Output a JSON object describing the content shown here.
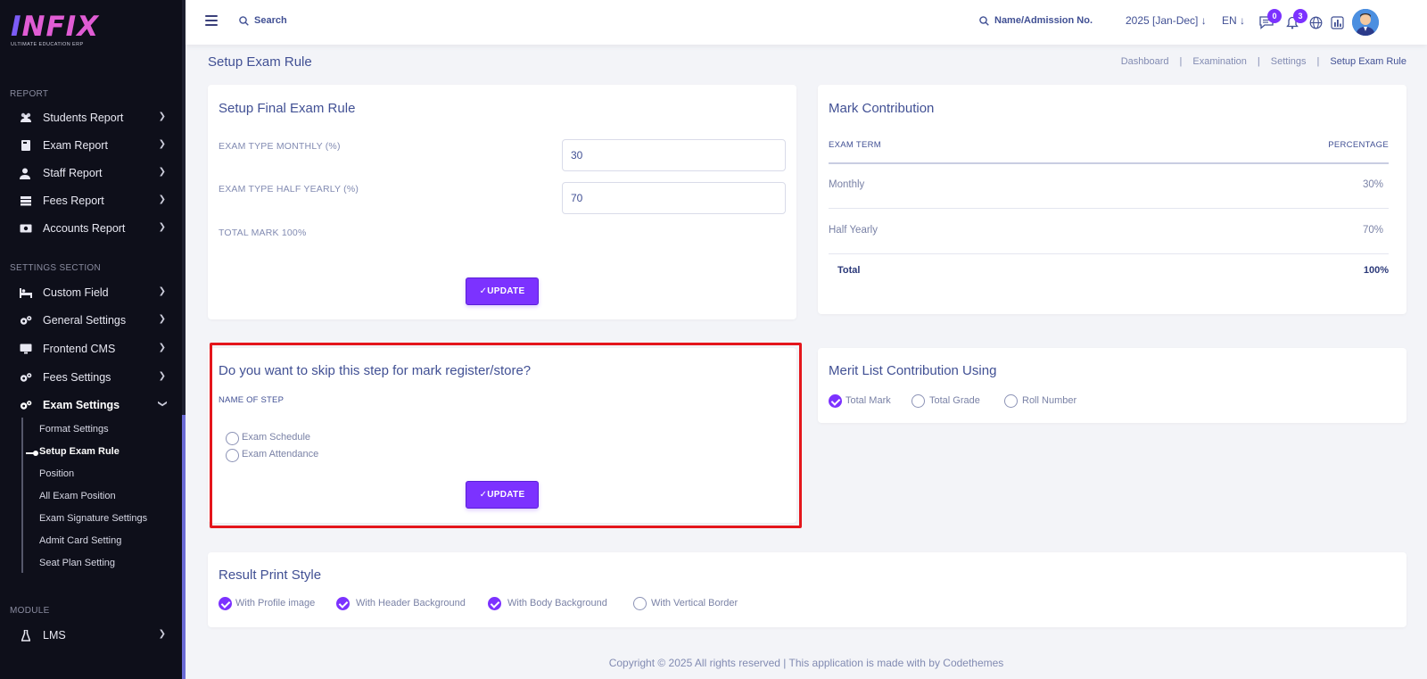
{
  "app": {
    "logo_text": "INFIX",
    "logo_subtitle": "ULTIMATE EDUCATION ERP"
  },
  "sidebar": {
    "sections": [
      {
        "title": "REPORT",
        "items": [
          {
            "label": "Students Report",
            "icon": "users-icon"
          },
          {
            "label": "Exam Report",
            "icon": "book-icon"
          },
          {
            "label": "Staff Report",
            "icon": "user-icon"
          },
          {
            "label": "Fees Report",
            "icon": "stack-icon"
          },
          {
            "label": "Accounts Report",
            "icon": "money-icon"
          }
        ]
      },
      {
        "title": "SETTINGS SECTION",
        "items": [
          {
            "label": "Custom Field",
            "icon": "bed-icon"
          },
          {
            "label": "General Settings",
            "icon": "gears-icon"
          },
          {
            "label": "Frontend CMS",
            "icon": "monitor-icon"
          },
          {
            "label": "Fees Settings",
            "icon": "gears-icon"
          },
          {
            "label": "Exam Settings",
            "icon": "gears-icon",
            "active": true
          }
        ]
      },
      {
        "title": "MODULE",
        "items": [
          {
            "label": "LMS",
            "icon": "flask-icon"
          }
        ]
      }
    ],
    "exam_settings_sub": [
      {
        "label": "Format Settings"
      },
      {
        "label": "Setup Exam Rule",
        "active": true
      },
      {
        "label": "Position"
      },
      {
        "label": "All Exam Position"
      },
      {
        "label": "Exam Signature Settings"
      },
      {
        "label": "Admit Card Setting"
      },
      {
        "label": "Seat Plan Setting"
      }
    ]
  },
  "topbar": {
    "search_placeholder": "Search",
    "admission_placeholder": "Name/Admission No.",
    "year": "2025 [Jan-Dec]",
    "language": "EN",
    "message_count": "0",
    "notification_count": "3"
  },
  "page": {
    "title": "Setup Exam Rule",
    "breadcrumb": [
      "Dashboard",
      "Examination",
      "Settings",
      "Setup Exam Rule"
    ]
  },
  "final_exam_rule": {
    "title": "Setup Final Exam Rule",
    "monthly_label": "EXAM TYPE MONTHLY (%)",
    "monthly_value": "30",
    "half_yearly_label": "EXAM TYPE HALF YEARLY (%)",
    "half_yearly_value": "70",
    "total_label": "TOTAL MARK 100%",
    "update_button": "✓UPDATE"
  },
  "mark_contribution": {
    "title": "Mark Contribution",
    "col_term": "EXAM TERM",
    "col_percentage": "PERCENTAGE",
    "rows": [
      {
        "term": "Monthly",
        "percentage": "30%"
      },
      {
        "term": "Half Yearly",
        "percentage": "70%"
      }
    ],
    "total_label": "Total",
    "total_value": "100%"
  },
  "skip_step": {
    "title": "Do you want to skip this step for mark register/store?",
    "name_label": "NAME OF STEP",
    "options": [
      {
        "label": "Exam Schedule",
        "checked": false
      },
      {
        "label": "Exam Attendance",
        "checked": false
      }
    ],
    "update_button": "✓UPDATE"
  },
  "merit_list": {
    "title": "Merit List Contribution Using",
    "options": [
      {
        "label": "Total Mark",
        "checked": true
      },
      {
        "label": "Total Grade",
        "checked": false
      },
      {
        "label": "Roll Number",
        "checked": false
      }
    ]
  },
  "result_print": {
    "title": "Result Print Style",
    "options": [
      {
        "label": "With Profile image",
        "checked": true
      },
      {
        "label": "With Header Background",
        "checked": true
      },
      {
        "label": "With Body Background",
        "checked": true
      },
      {
        "label": "With Vertical Border",
        "checked": false
      }
    ]
  },
  "footer": {
    "text": "Copyright © 2025 All rights reserved | This application is made with by Codethemes"
  },
  "colors": {
    "accent": "#7c32ff",
    "text": "#415094",
    "muted": "#828bb2",
    "sidebar_bg": "#0e0f1a",
    "highlight": "#e4161c"
  }
}
